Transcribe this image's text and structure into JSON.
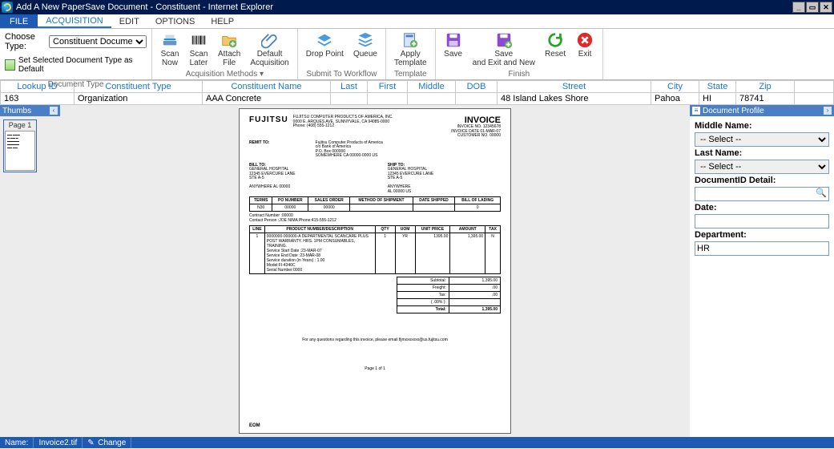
{
  "window": {
    "title": "Add A New PaperSave Document - Constituent - Internet Explorer"
  },
  "menu": {
    "file": "FILE",
    "tabs": [
      {
        "label": "ACQUISITION",
        "active": true
      },
      {
        "label": "EDIT",
        "active": false
      },
      {
        "label": "OPTIONS",
        "active": false
      },
      {
        "label": "HELP",
        "active": false
      }
    ]
  },
  "ribbon": {
    "docType": {
      "chooseLabel": "Choose Type:",
      "selected": "Constituent Documentation",
      "setDefaultLabel": "Set Selected Document Type as Default",
      "groupLabel": "Document Type"
    },
    "acquisition": {
      "scanNow": "Scan\nNow",
      "scanLater": "Scan\nLater",
      "attachFile": "Attach\nFile",
      "defaultAcq": "Default\nAcquisition",
      "groupLabel": "Acquisition Methods  ▾"
    },
    "workflow": {
      "dropPoint": "Drop Point",
      "queue": "Queue",
      "groupLabel": "Submit To Workflow"
    },
    "template": {
      "apply": "Apply\nTemplate",
      "groupLabel": "Template"
    },
    "finish": {
      "save": "Save",
      "saveExitNew": "Save\nand Exit and New",
      "reset": "Reset",
      "exit": "Exit",
      "groupLabel": "Finish"
    }
  },
  "grid": {
    "headers": [
      "Lookup ID",
      "Constituent Type",
      "Constituent Name",
      "Last",
      "First",
      "Middle",
      "DOB",
      "Street",
      "City",
      "State",
      "Zip"
    ],
    "row": {
      "lookupId": "163",
      "constituentType": "Organization",
      "constituentName": "AAA Concrete",
      "last": "",
      "first": "",
      "middle": "",
      "dob": "",
      "street": "48 Island Lakes Shore",
      "city": "Pahoa",
      "state": "HI",
      "zip": "78741"
    }
  },
  "thumbs": {
    "title": "Thumbs",
    "page1": "Page 1"
  },
  "profile": {
    "title": "Document Profile",
    "middleNameLabel": "Middle Name:",
    "middleNameValue": "-- Select --",
    "lastNameLabel": "Last Name:",
    "lastNameValue": "-- Select --",
    "docIdLabel": "DocumentID Detail:",
    "docIdValue": "",
    "dateLabel": "Date:",
    "dateValue": "",
    "deptLabel": "Department:",
    "deptValue": "HR"
  },
  "footer": {
    "nameLabel": "Name:",
    "fileName": "Invoice2.tif",
    "change": "Change"
  },
  "invoice": {
    "brand": "FUJITSU",
    "companyLines": "FUJITSU COMPUTER PRODUCTS OF AMERICA, INC.\n0000 E. ARQUES AVE, SUNNYVALE, CA 94085-0000\nPhone: (408) 555-1212",
    "remitLabel": "REMIT TO:",
    "remitLines": "Fujitsu Computer Products of America\nc/o Bank of America\nP.O. Box 000000\nSOMEWHERE CA 00000-0000 US",
    "invoiceTitle": "INVOICE",
    "invoiceNo": "INVOICE NO. 12345678",
    "invoiceDate": "INVOICE DATE 01-MAR-07",
    "customerNo": "CUSTOMER NO. 00000",
    "billToLabel": "BILL TO:",
    "billToLines": "GENERAL HOSPITAL\n12345 EVERCURE LANE\nSTE A-5\n\nANYWHERE AL 00000",
    "shipToLabel": "SHIP TO:",
    "shipToLines": "GENERAL HOSPITAL\n12345 EVERCURE LANE\nSTE A-5\n\nANYWHERE\nAL 00000 US",
    "termsHeaders": [
      "TERMS",
      "PO NUMBER",
      "SALES ORDER",
      "METHOD OF SHIPMENT",
      "DATE SHIPPED",
      "BILL OF LADING"
    ],
    "termsRow": [
      "N30",
      "00000",
      "00000",
      "",
      "",
      "0"
    ],
    "contractNumberLabel": "Contract Number",
    "contractNumber": ":00000",
    "contactPersonLabel": "Contact Person",
    "contactPerson": ":JOE NIMA    Phone:415-555-1212",
    "lineHeaders": [
      "LINE",
      "PRODUCT NUMBER/DESCRIPTION",
      "QTY",
      "UOM",
      "UNIT PRICE",
      "AMOUNT",
      "TAX"
    ],
    "lineItem": {
      "line": "1",
      "desc": "0000000-000000-A DEPARTMENTAL SCANCARE PLUS\nPOST WARRANTY. HRS. 1PM CONSUMABLES, TRAINING.\nService Start Date :23-MAR-07\nService  End  Date :23-MAR-08\nService duration (in Years) : 1.00\nModel:FI-4340C\nSerial Number:0000",
      "qty": "1",
      "uom": "YR",
      "unitPrice": "1395.00",
      "amount": "1,395.00",
      "tax": "N"
    },
    "totals": {
      "subtotalLabel": "Subtotal:",
      "subtotal": "1,395.00",
      "freightLabel": "Freight:",
      "freight": ".00",
      "taxLabel": "Tax:",
      "tax": ".00",
      "pctLabel": "( .00% ):",
      "pct": "",
      "totalLabel": "Total:",
      "total": "1,395.00"
    },
    "footNote": "For any questions regarding this invoice, please email fijmxxxxxxx@us.fujitsu.com",
    "pager": "Page     1     of     1",
    "eom": "EOM"
  }
}
